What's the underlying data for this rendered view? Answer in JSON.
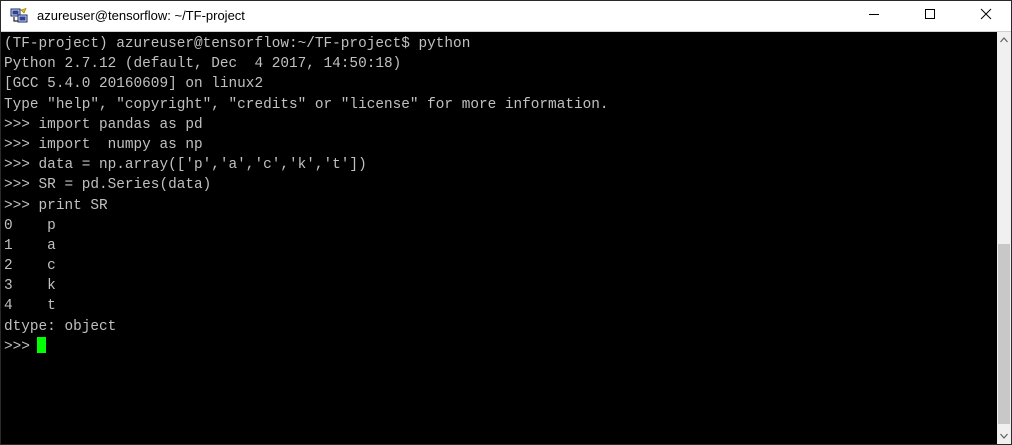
{
  "window": {
    "title": "azureuser@tensorflow: ~/TF-project",
    "controls": {
      "minimize_icon": "minimize-icon",
      "maximize_icon": "maximize-icon",
      "close_icon": "close-icon"
    }
  },
  "terminal": {
    "background": "#000000",
    "foreground": "#c0c0c0",
    "cursor_color": "#00ff00",
    "lines": [
      "(TF-project) azureuser@tensorflow:~/TF-project$ python",
      "Python 2.7.12 (default, Dec  4 2017, 14:50:18)",
      "[GCC 5.4.0 20160609] on linux2",
      "Type \"help\", \"copyright\", \"credits\" or \"license\" for more information.",
      ">>> import pandas as pd",
      ">>> import  numpy as np",
      ">>> data = np.array(['p','a','c','k','t'])",
      ">>> SR = pd.Series(data)",
      ">>> print SR",
      "0    p",
      "1    a",
      "2    c",
      "3    k",
      "4    t",
      "dtype: object"
    ],
    "prompt": ">>>"
  }
}
